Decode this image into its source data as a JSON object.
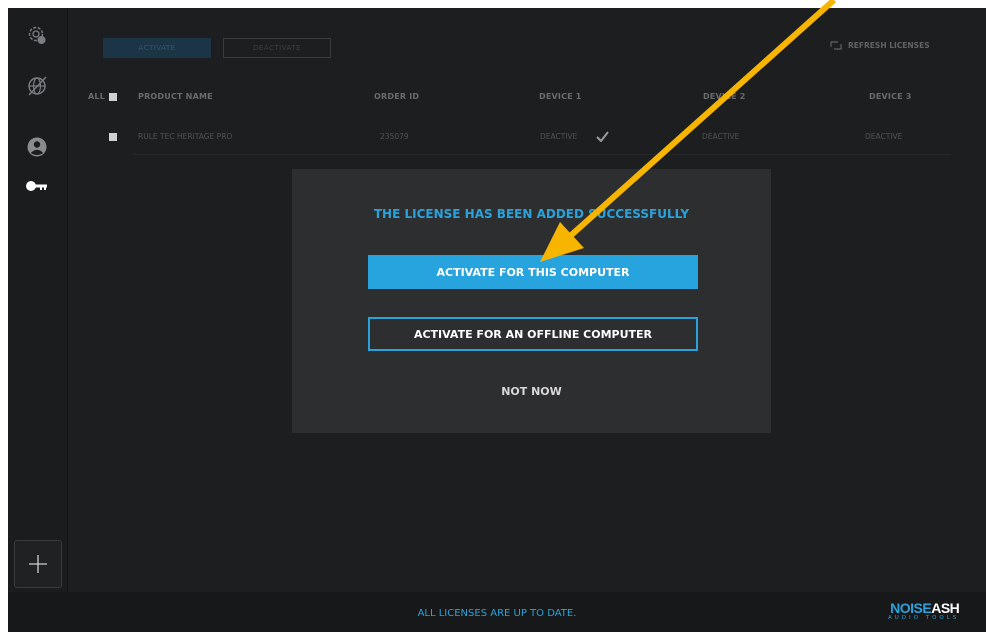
{
  "toolbar": {
    "activate_label": "ACTIVATE",
    "deactivate_label": "DEACTIVATE",
    "refresh_label": "REFRESH LICENSES"
  },
  "table": {
    "all_label": "ALL",
    "headers": [
      "PRODUCT NAME",
      "ORDER ID",
      "DEVICE 1",
      "DEVICE 2",
      "DEVICE 3"
    ],
    "rows": [
      {
        "product": "RULE TEC HERITAGE PRO",
        "order_id": "235079",
        "device1": "DEACTIVE",
        "device2": "DEACTIVE",
        "device3": "DEACTIVE"
      }
    ]
  },
  "modal": {
    "title": "THE LICENSE HAS BEEN ADDED SUCCESSFULLY",
    "primary_label": "ACTIVATE FOR THIS COMPUTER",
    "secondary_label": "ACTIVATE FOR AN OFFLINE COMPUTER",
    "dismiss_label": "NOT NOW"
  },
  "footer": {
    "status": "ALL LICENSES ARE UP TO DATE.",
    "logo_part1": "NOISE",
    "logo_part2": "ASH",
    "logo_sub": "AUDIO TOOLS"
  },
  "sidebar": {
    "icons": [
      "settings-icon",
      "network-icon",
      "user-icon",
      "key-icon"
    ],
    "add_icon": "plus-icon"
  },
  "colors": {
    "accent": "#27a4dd",
    "background": "#1d1e20",
    "modal": "#2d2e30",
    "arrow": "#f7b500"
  }
}
